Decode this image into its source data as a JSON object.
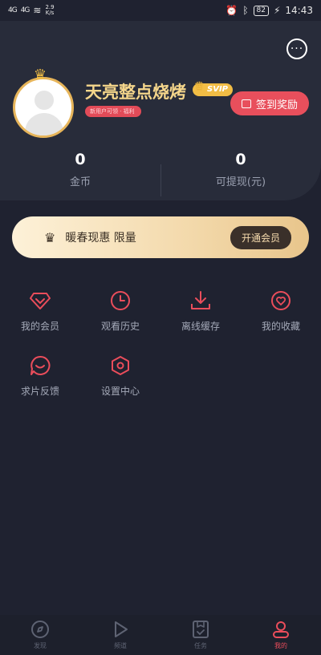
{
  "status_bar": {
    "signal1": "4G",
    "signal2": "4G",
    "net_speed_value": "2.9",
    "net_speed_unit": "K/s",
    "battery": "82",
    "time": "14:43"
  },
  "profile": {
    "username": "天亮整点烧烤",
    "vip_badge": "SVIP",
    "tag_text": "新用户可领 · 福利",
    "checkin_label": "签到奖励"
  },
  "stats": [
    {
      "value": "0",
      "label": "金币"
    },
    {
      "value": "0",
      "label": "可提现(元)"
    }
  ],
  "vip_banner": {
    "text": "暖春现惠 限量",
    "button_label": "开通会员"
  },
  "menu": [
    {
      "icon": "diamond-icon",
      "label": "我的会员"
    },
    {
      "icon": "clock-icon",
      "label": "观看历史"
    },
    {
      "icon": "download-icon",
      "label": "离线缓存"
    },
    {
      "icon": "heart-icon",
      "label": "我的收藏"
    },
    {
      "icon": "chat-bubble-icon",
      "label": "求片反馈"
    },
    {
      "icon": "hexagon-settings-icon",
      "label": "设置中心"
    }
  ],
  "tabs": [
    {
      "icon": "compass-icon",
      "label": "发现",
      "active": false
    },
    {
      "icon": "play-icon",
      "label": "频道",
      "active": false
    },
    {
      "icon": "task-icon",
      "label": "任务",
      "active": false
    },
    {
      "icon": "user-icon",
      "label": "我的",
      "active": true
    }
  ],
  "colors": {
    "background": "#1f2230",
    "card": "#282c3a",
    "accent": "#e84f5c",
    "gold": "#f5d68b"
  }
}
